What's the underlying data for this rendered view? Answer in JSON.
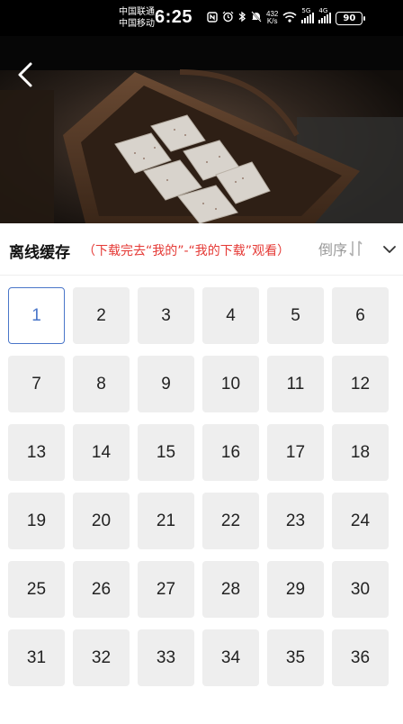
{
  "status_bar": {
    "carrier_1": "中国联通",
    "carrier_2": "中国移动",
    "time": "6:25",
    "speed_value": "432",
    "speed_unit": "K/s",
    "battery": "90",
    "net_1": "5G",
    "net_2": "4G"
  },
  "header": {
    "title": "离线缓存",
    "subtitle": "（下载完去“我的”-“我的下载”观看）",
    "order_label": "倒序"
  },
  "episodes": [
    "1",
    "2",
    "3",
    "4",
    "5",
    "6",
    "7",
    "8",
    "9",
    "10",
    "11",
    "12",
    "13",
    "14",
    "15",
    "16",
    "17",
    "18",
    "19",
    "20",
    "21",
    "22",
    "23",
    "24",
    "25",
    "26",
    "27",
    "28",
    "29",
    "30",
    "31",
    "32",
    "33",
    "34",
    "35",
    "36"
  ],
  "selected_episode": "1",
  "colors": {
    "accent": "#4a76c9",
    "subtitle": "#e53935",
    "tile": "#eeeeee"
  }
}
